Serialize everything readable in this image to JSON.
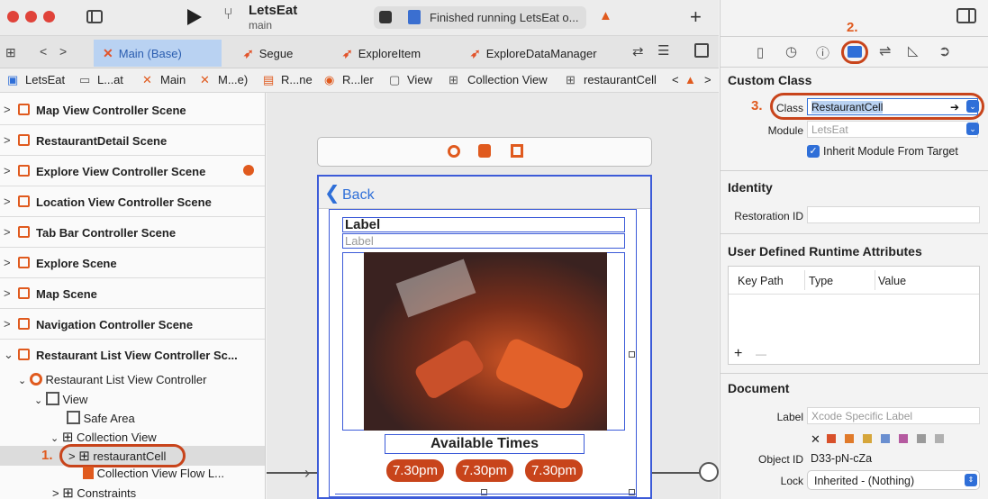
{
  "window": {
    "app": "LetsEat",
    "branch": "main",
    "status": "Finished running LetsEat o..."
  },
  "tabs": [
    "Main (Base)",
    "Segue",
    "ExploreItem",
    "ExploreDataManager"
  ],
  "breadcrumbs": [
    "LetsEat",
    "L...at",
    "Main",
    "M...e)",
    "R...ne",
    "R...ler",
    "View",
    "Collection View",
    "restaurantCell"
  ],
  "scenes": [
    "Map View Controller Scene",
    "RestaurantDetail Scene",
    "Explore View Controller Scene",
    "Location View Controller Scene",
    "Tab Bar Controller Scene",
    "Explore Scene",
    "Map Scene",
    "Navigation Controller Scene",
    "Restaurant List View Controller Sc..."
  ],
  "tree": {
    "controller": "Restaurant List View Controller",
    "view": "View",
    "safe_area": "Safe Area",
    "collection_view": "Collection View",
    "cell": "restaurantCell",
    "flow_layout": "Collection View Flow L...",
    "constraints": "Constraints"
  },
  "canvas": {
    "back": "Back",
    "label_bold": "Label",
    "label_light": "Label",
    "available": "Available Times",
    "times": [
      "7.30pm",
      "7.30pm",
      "7.30pm"
    ]
  },
  "inspector": {
    "custom_class": {
      "header": "Custom Class",
      "class_label": "Class",
      "class_value": "RestaurantCell",
      "module_label": "Module",
      "module_placeholder": "LetsEat",
      "inherit": "Inherit Module From Target"
    },
    "identity": {
      "header": "Identity",
      "restoration_label": "Restoration ID"
    },
    "runtime": {
      "header": "User Defined Runtime Attributes",
      "cols": [
        "Key Path",
        "Type",
        "Value"
      ],
      "add": "+",
      "remove": "—"
    },
    "document": {
      "header": "Document",
      "label_label": "Label",
      "label_placeholder": "Xcode Specific Label",
      "object_id_label": "Object ID",
      "object_id": "D33-pN-cZa",
      "lock_label": "Lock",
      "lock_value": "Inherited - (Nothing)"
    }
  },
  "annotations": {
    "one": "1.",
    "two": "2.",
    "three": "3."
  },
  "colors": {
    "accent": "#e05a1e",
    "selection": "#2f6fd8"
  }
}
